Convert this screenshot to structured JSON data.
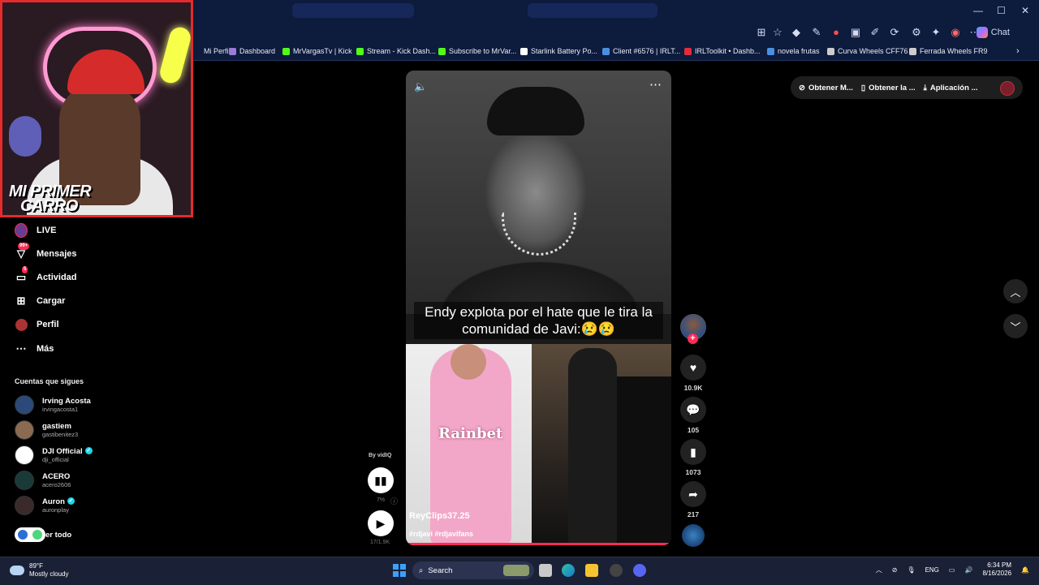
{
  "browser": {
    "window_controls": [
      "—",
      "☐",
      "✕"
    ],
    "chat_label": "Chat",
    "bookmarks": [
      {
        "label": "Mi Perfil",
        "color": "#9b7bd6"
      },
      {
        "label": "Dashboard",
        "color": "#9b7bd6"
      },
      {
        "label": "MrVargasTv | Kick",
        "color": "#53fc18"
      },
      {
        "label": "Stream - Kick Dash...",
        "color": "#53fc18"
      },
      {
        "label": "Subscribe to MrVar...",
        "color": "#53fc18"
      },
      {
        "label": "Starlink Battery Po...",
        "color": "#ffffff"
      },
      {
        "label": "Client #6576 | IRLT...",
        "color": "#4a90e2"
      },
      {
        "label": "IRLToolkit • Dashb...",
        "color": "#e22b3b"
      },
      {
        "label": "novela frutas",
        "color": "#4a90e2"
      },
      {
        "label": "Curva Wheels CFF76",
        "color": "#cccccc"
      },
      {
        "label": "Ferrada Wheels FR9",
        "color": "#cccccc"
      }
    ]
  },
  "webcam": {
    "overlay_text_line1": "MI PRIMER",
    "overlay_text_line2": "CARRO"
  },
  "nav": {
    "items": [
      {
        "label": "LIVE",
        "icon": "live-avatar-icon"
      },
      {
        "label": "Mensajes",
        "icon": "messages-icon",
        "badge": "99+"
      },
      {
        "label": "Actividad",
        "icon": "activity-icon",
        "badge": "5"
      },
      {
        "label": "Cargar",
        "icon": "upload-icon"
      },
      {
        "label": "Perfil",
        "icon": "profile-icon"
      },
      {
        "label": "Más",
        "icon": "more-icon"
      }
    ],
    "following_title": "Cuentas que sigues",
    "accounts": [
      {
        "name": "Irving Acosta",
        "handle": "irvingacosta1",
        "verified": false
      },
      {
        "name": "gastiem",
        "handle": "gastibenitez3",
        "verified": false
      },
      {
        "name": "DJI Official",
        "handle": "dji_official",
        "verified": true
      },
      {
        "name": "ACERO",
        "handle": "acero2606",
        "verified": false
      },
      {
        "name": "Auron",
        "handle": "auronplay",
        "verified": true
      }
    ],
    "see_all": "er todo"
  },
  "video": {
    "caption": "Endy explota por el hate que le tira la comunidad de Javi:😢😢",
    "watermark": "Rainbet",
    "author": "ReyClips37.25",
    "tags": "#rdjavi #rdjavifans",
    "likes": "10.9K",
    "comments": "105",
    "saves": "1073",
    "shares": "217"
  },
  "vidiq": {
    "by": "By vidIQ",
    "stat1": "7%",
    "stat2": "17/1.9K"
  },
  "top_actions": [
    {
      "label": "Obtener M..."
    },
    {
      "label": "Obtener la ..."
    },
    {
      "label": "Aplicación ..."
    }
  ],
  "taskbar": {
    "temp": "89°F",
    "weather": "Mostly cloudy",
    "search": "Search",
    "lang": "ENG",
    "time": "6:34 PM",
    "date": "8/16/2026"
  }
}
